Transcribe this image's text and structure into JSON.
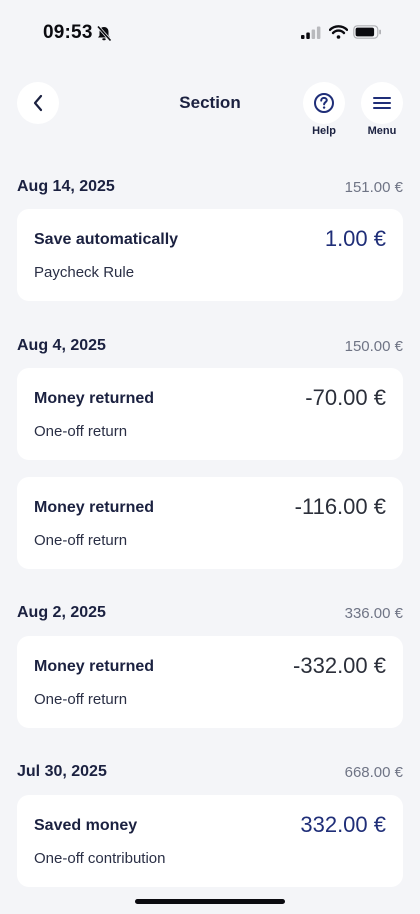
{
  "status_bar": {
    "time": "09:53"
  },
  "nav": {
    "title": "Section",
    "help_label": "Help",
    "menu_label": "Menu"
  },
  "groups": [
    {
      "date": "Aug 14, 2025",
      "total": "151.00 €",
      "items": [
        {
          "title": "Save automatically",
          "subtitle": "Paycheck Rule",
          "amount": "1.00 €"
        }
      ]
    },
    {
      "date": "Aug 4, 2025",
      "total": "150.00 €",
      "items": [
        {
          "title": "Money returned",
          "subtitle": "One-off return",
          "amount": "-70.00 €"
        },
        {
          "title": "Money returned",
          "subtitle": "One-off return",
          "amount": "-116.00 €"
        }
      ]
    },
    {
      "date": "Aug 2, 2025",
      "total": "336.00 €",
      "items": [
        {
          "title": "Money returned",
          "subtitle": "One-off return",
          "amount": "-332.00 €"
        }
      ]
    },
    {
      "date": "Jul 30, 2025",
      "total": "668.00 €",
      "items": [
        {
          "title": "Saved money",
          "subtitle": "One-off contribution",
          "amount": "332.00 €"
        }
      ]
    }
  ],
  "colors": {
    "background": "#f4f5f8",
    "card": "#ffffff",
    "primary_text": "#1b2140",
    "positive_amount": "#1f2e78",
    "negative_amount": "#2b2f3a",
    "muted_text": "#6f7485"
  },
  "icons": {
    "back": "chevron-left-icon",
    "help": "question-circle-icon",
    "menu": "hamburger-menu-icon",
    "silent": "bell-off-icon"
  }
}
